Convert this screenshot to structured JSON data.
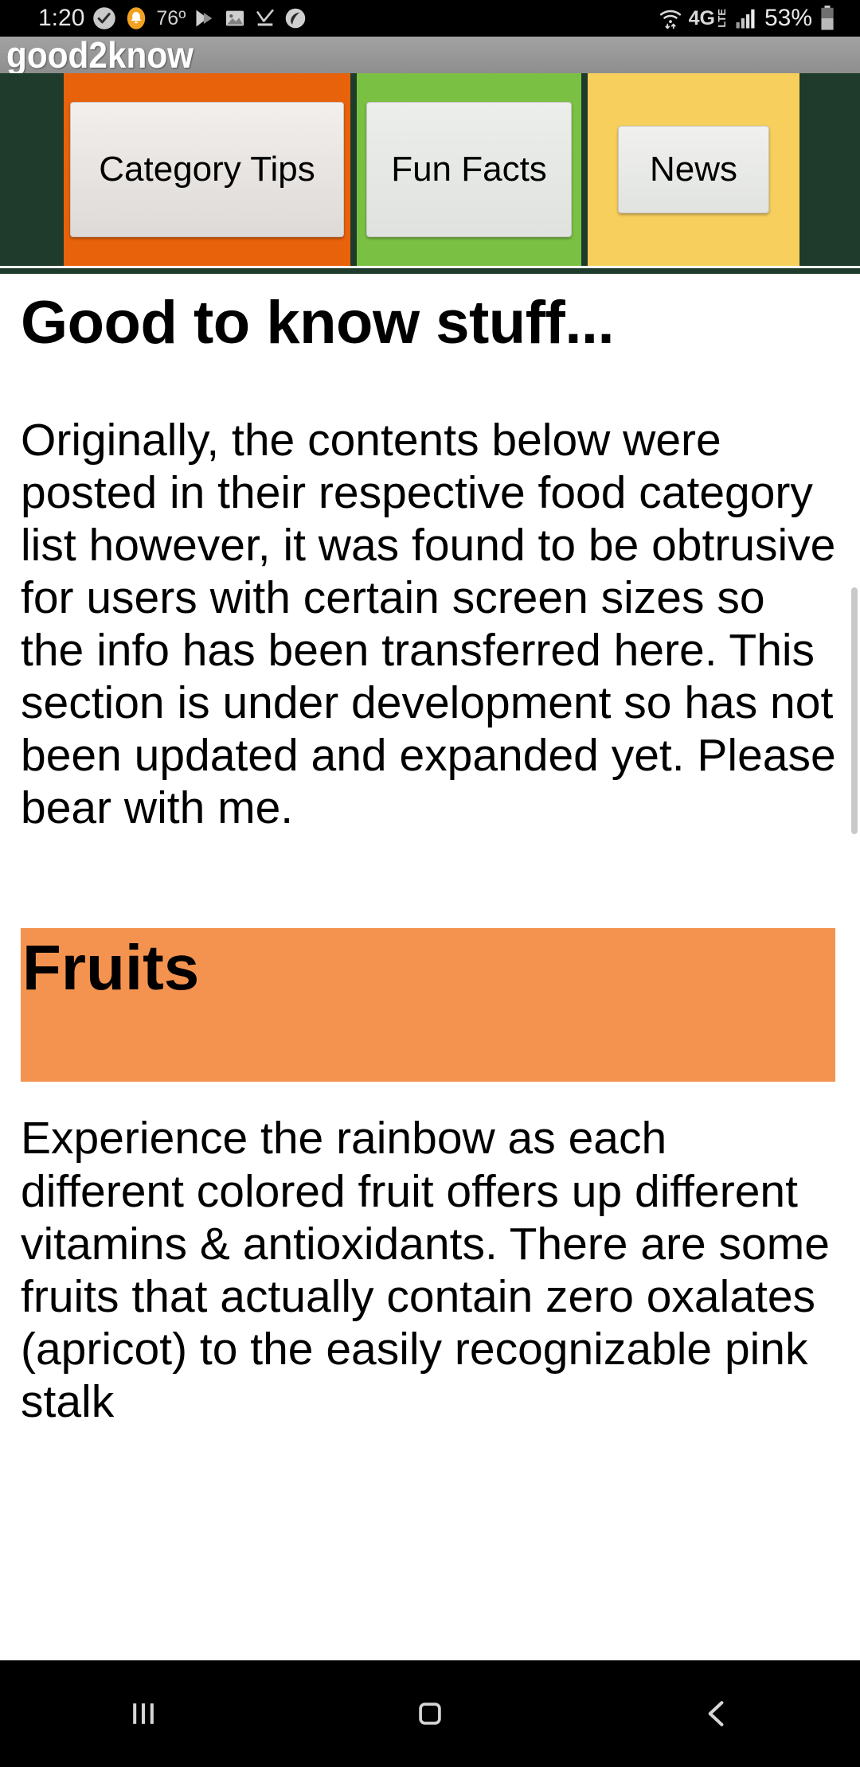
{
  "status_bar": {
    "time": "1:20",
    "temperature": "76º",
    "battery_percent": "53%",
    "network_type": "4G",
    "network_subtype": "LTE",
    "icons": [
      "check-circle-icon",
      "bell-icon",
      "fast-forward-icon",
      "image-icon",
      "download-check-icon",
      "leaf-icon",
      "wifi-icon",
      "signal-bars-icon",
      "battery-icon"
    ]
  },
  "app": {
    "title": "good2know"
  },
  "tabs": [
    {
      "label": "Category Tips",
      "accent": "#e8620c",
      "selected": true
    },
    {
      "label": "Fun Facts",
      "accent": "#7ac143",
      "selected": false
    },
    {
      "label": "News",
      "accent": "#f7cf5d",
      "selected": false
    }
  ],
  "page": {
    "title": "Good to know stuff...",
    "intro": "Originally, the contents below were posted in their respective food category list however, it was found to be obtrusive for users with certain screen sizes so the info has been transferred here. This section is under development so has not been updated and expanded yet. Please bear with me."
  },
  "sections": [
    {
      "heading": "Fruits",
      "banner_color": "#f4934f",
      "text": "Experience the rainbow as each different colored fruit offers up different vitamins & antioxidants. There are some fruits that actually contain zero oxalates (apricot) to the easily recognizable pink stalk"
    }
  ],
  "nav_bar": {
    "recents_label": "recent-apps",
    "home_label": "home",
    "back_label": "back"
  },
  "colors": {
    "tab_bar_background": "#1e3b2b",
    "title_bar": "#999999",
    "fruits_banner": "#f4934f",
    "orange_tab": "#e8620c",
    "green_tab": "#7ac143",
    "yellow_tab": "#f7cf5d"
  }
}
